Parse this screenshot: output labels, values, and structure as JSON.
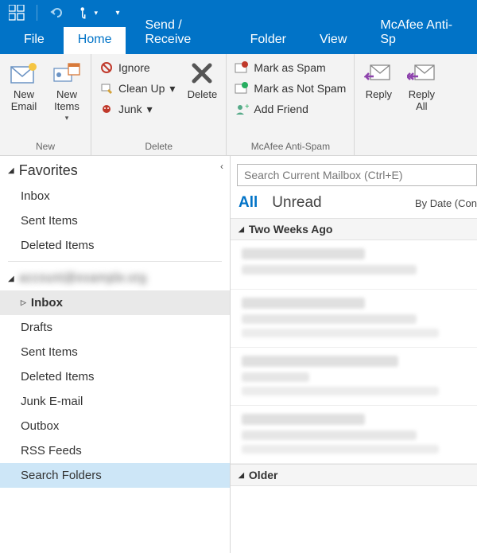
{
  "menubar": {
    "tabs": [
      "File",
      "Home",
      "Send / Receive",
      "Folder",
      "View",
      "McAfee Anti-Sp"
    ],
    "active_index": 1
  },
  "ribbon": {
    "new_group": {
      "label": "New",
      "new_email": "New\nEmail",
      "new_items": "New\nItems"
    },
    "delete_group": {
      "label": "Delete",
      "ignore": "Ignore",
      "cleanup": "Clean Up",
      "junk": "Junk",
      "delete": "Delete"
    },
    "spam_group": {
      "label": "McAfee Anti-Spam",
      "mark_spam": "Mark as Spam",
      "mark_not_spam": "Mark as Not Spam",
      "add_friend": "Add Friend"
    },
    "respond_group": {
      "reply": "Reply",
      "reply_all": "Reply\nAll"
    }
  },
  "nav": {
    "favorites_label": "Favorites",
    "favorites": [
      "Inbox",
      "Sent Items",
      "Deleted Items"
    ],
    "account_label": "account@example.org",
    "folders": [
      "Inbox",
      "Drafts",
      "Sent Items",
      "Deleted Items",
      "Junk E-mail",
      "Outbox",
      "RSS Feeds",
      "Search Folders"
    ],
    "expanded_folder_index": 0,
    "selected_folder_index": 7
  },
  "main": {
    "search_placeholder": "Search Current Mailbox (Ctrl+E)",
    "filters": {
      "all": "All",
      "unread": "Unread",
      "sort": "By Date (Con"
    },
    "groups": [
      "Two Weeks Ago",
      "Older"
    ]
  }
}
